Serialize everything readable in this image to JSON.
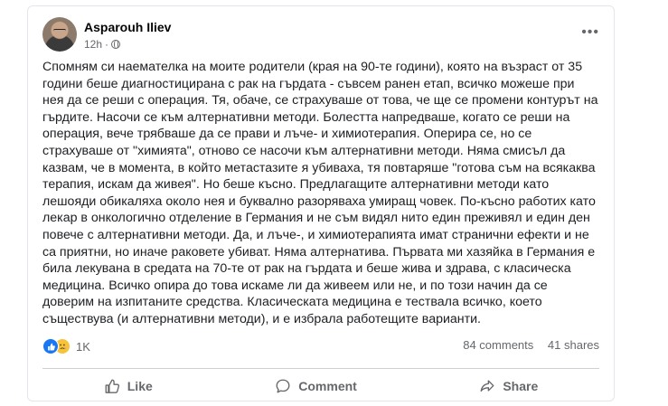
{
  "post": {
    "author": "Asparouh Iliev",
    "time": "12h",
    "separator": "·",
    "more_label": "•••",
    "body_lines": [
      "Спомням си наемателка на моите родители (края на 90-те години), която на възраст от 35",
      "години беше диагностицирана с рак на гърдата - съвсем ранен етап, всичко можеше при",
      "нея да се реши с операция. Тя, обаче, се страхуваше от това, че ще се промени контурът на",
      "гърдите. Насочи се към алтернативни методи. Болестта напредваше, когато се реши на",
      "операция, вече трябваше да се прави и лъче- и химиотерапия. Оперира се, но се",
      "страхуваше от \"химията\", отново се насочи към алтернативни методи. Няма смисъл да",
      "казвам, че в момента, в който метастазите я убиваха, тя повтаряше \"готова съм на всякаква",
      "терапия, искам да живея\". Но беше късно. Предлагащите алтернативни методи като",
      "лешояди обикаляха около нея и буквално разоряваха умиращ човек. По-късно работих като",
      "лекар в онкологично отделение в Германия и не съм видял нито един преживял и един ден",
      "повече с алтернативни методи. Да, и лъче-, и химиотерапията имат странични ефекти и не",
      "са приятни, но иначе раковете убиват. Няма алтернатива. Първата ми хазяйка в Германия е",
      "била лекувана в средата на 70-те от рак на гърдата и беше жива и здрава, с класическа",
      "медицина. Всичко опира до това искаме ли да живеем или не, и по този начин да се",
      "доверим на изпитаните средства. Класическата медицина е тествала всичко, което",
      "съществува (и алтернативни методи), и е избрала работещите варианти."
    ]
  },
  "stats": {
    "reactions_count": "1K",
    "comments": "84 comments",
    "shares": "41 shares"
  },
  "actions": {
    "like": "Like",
    "comment": "Comment",
    "share": "Share"
  },
  "icons": {
    "like_reaction": "thumbs-up-icon",
    "sad_reaction": "sad-face-icon",
    "privacy": "globe-icon"
  },
  "colors": {
    "like_blue": "#1877f2",
    "text_secondary": "#65676b"
  }
}
